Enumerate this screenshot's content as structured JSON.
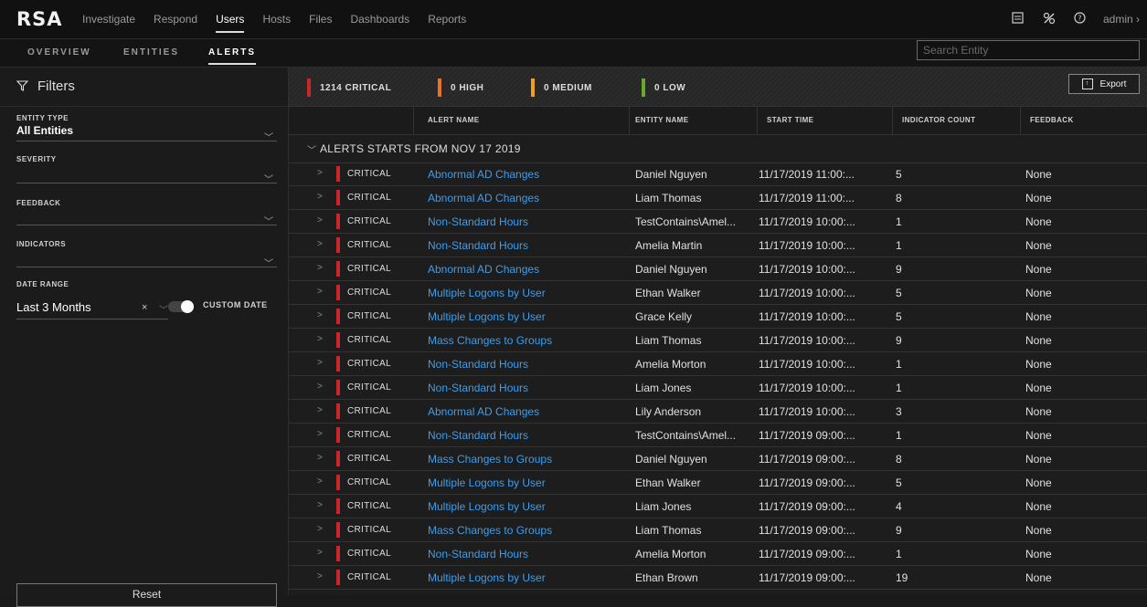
{
  "app": {
    "logo": "RSA",
    "nav": [
      "Investigate",
      "Respond",
      "Users",
      "Hosts",
      "Files",
      "Dashboards",
      "Reports"
    ],
    "active_nav": "Users",
    "user": "admin ›"
  },
  "subtabs": [
    "OVERVIEW",
    "ENTITIES",
    "ALERTS"
  ],
  "active_subtab": "ALERTS",
  "search": {
    "placeholder": "Search Entity"
  },
  "filters": {
    "title": "Filters",
    "entity_type_label": "ENTITY TYPE",
    "entity_type_value": "All Entities",
    "severity_label": "SEVERITY",
    "feedback_label": "FEEDBACK",
    "indicators_label": "INDICATORS",
    "date_range_label": "DATE RANGE",
    "date_range_value": "Last 3 Months",
    "clear_symbol": "×",
    "custom_date_label": "CUSTOM DATE",
    "reset_label": "Reset"
  },
  "severity_summary": [
    {
      "label": "1214 CRITICAL",
      "color": "#c8262b"
    },
    {
      "label": "0 HIGH",
      "color": "#e8722c"
    },
    {
      "label": "0 MEDIUM",
      "color": "#f0a11b"
    },
    {
      "label": "0 LOW",
      "color": "#6aa632"
    }
  ],
  "export_label": "Export",
  "columns": {
    "alert_name": "ALERT NAME",
    "entity_name": "ENTITY NAME",
    "start_time": "START TIME",
    "indicator_count": "INDICATOR COUNT",
    "feedback": "FEEDBACK"
  },
  "group_label": "ALERTS STARTS FROM  NOV 17 2019",
  "rows": [
    {
      "severity": "CRITICAL",
      "alert": "Abnormal AD Changes",
      "entity": "Daniel Nguyen",
      "time": "11/17/2019 11:00:...",
      "count": "5",
      "feedback": "None"
    },
    {
      "severity": "CRITICAL",
      "alert": "Abnormal AD Changes",
      "entity": "Liam Thomas",
      "time": "11/17/2019 11:00:...",
      "count": "8",
      "feedback": "None"
    },
    {
      "severity": "CRITICAL",
      "alert": "Non-Standard Hours",
      "entity": "TestContains\\Amel...",
      "time": "11/17/2019 10:00:...",
      "count": "1",
      "feedback": "None"
    },
    {
      "severity": "CRITICAL",
      "alert": "Non-Standard Hours",
      "entity": "Amelia Martin",
      "time": "11/17/2019 10:00:...",
      "count": "1",
      "feedback": "None"
    },
    {
      "severity": "CRITICAL",
      "alert": "Abnormal AD Changes",
      "entity": "Daniel Nguyen",
      "time": "11/17/2019 10:00:...",
      "count": "9",
      "feedback": "None"
    },
    {
      "severity": "CRITICAL",
      "alert": "Multiple Logons by User",
      "entity": "Ethan Walker",
      "time": "11/17/2019 10:00:...",
      "count": "5",
      "feedback": "None"
    },
    {
      "severity": "CRITICAL",
      "alert": "Multiple Logons by User",
      "entity": "Grace Kelly",
      "time": "11/17/2019 10:00:...",
      "count": "5",
      "feedback": "None"
    },
    {
      "severity": "CRITICAL",
      "alert": "Mass Changes to Groups",
      "entity": "Liam Thomas",
      "time": "11/17/2019 10:00:...",
      "count": "9",
      "feedback": "None"
    },
    {
      "severity": "CRITICAL",
      "alert": "Non-Standard Hours",
      "entity": "Amelia Morton",
      "time": "11/17/2019 10:00:...",
      "count": "1",
      "feedback": "None"
    },
    {
      "severity": "CRITICAL",
      "alert": "Non-Standard Hours",
      "entity": "Liam Jones",
      "time": "11/17/2019 10:00:...",
      "count": "1",
      "feedback": "None"
    },
    {
      "severity": "CRITICAL",
      "alert": "Abnormal AD Changes",
      "entity": "Lily Anderson",
      "time": "11/17/2019 10:00:...",
      "count": "3",
      "feedback": "None"
    },
    {
      "severity": "CRITICAL",
      "alert": "Non-Standard Hours",
      "entity": "TestContains\\Amel...",
      "time": "11/17/2019 09:00:...",
      "count": "1",
      "feedback": "None"
    },
    {
      "severity": "CRITICAL",
      "alert": "Mass Changes to Groups",
      "entity": "Daniel Nguyen",
      "time": "11/17/2019 09:00:...",
      "count": "8",
      "feedback": "None"
    },
    {
      "severity": "CRITICAL",
      "alert": "Multiple Logons by User",
      "entity": "Ethan Walker",
      "time": "11/17/2019 09:00:...",
      "count": "5",
      "feedback": "None"
    },
    {
      "severity": "CRITICAL",
      "alert": "Multiple Logons by User",
      "entity": "Liam Jones",
      "time": "11/17/2019 09:00:...",
      "count": "4",
      "feedback": "None"
    },
    {
      "severity": "CRITICAL",
      "alert": "Mass Changes to Groups",
      "entity": "Liam Thomas",
      "time": "11/17/2019 09:00:...",
      "count": "9",
      "feedback": "None"
    },
    {
      "severity": "CRITICAL",
      "alert": "Non-Standard Hours",
      "entity": "Amelia Morton",
      "time": "11/17/2019 09:00:...",
      "count": "1",
      "feedback": "None"
    },
    {
      "severity": "CRITICAL",
      "alert": "Multiple Logons by User",
      "entity": "Ethan Brown",
      "time": "11/17/2019 09:00:...",
      "count": "19",
      "feedback": "None"
    }
  ]
}
